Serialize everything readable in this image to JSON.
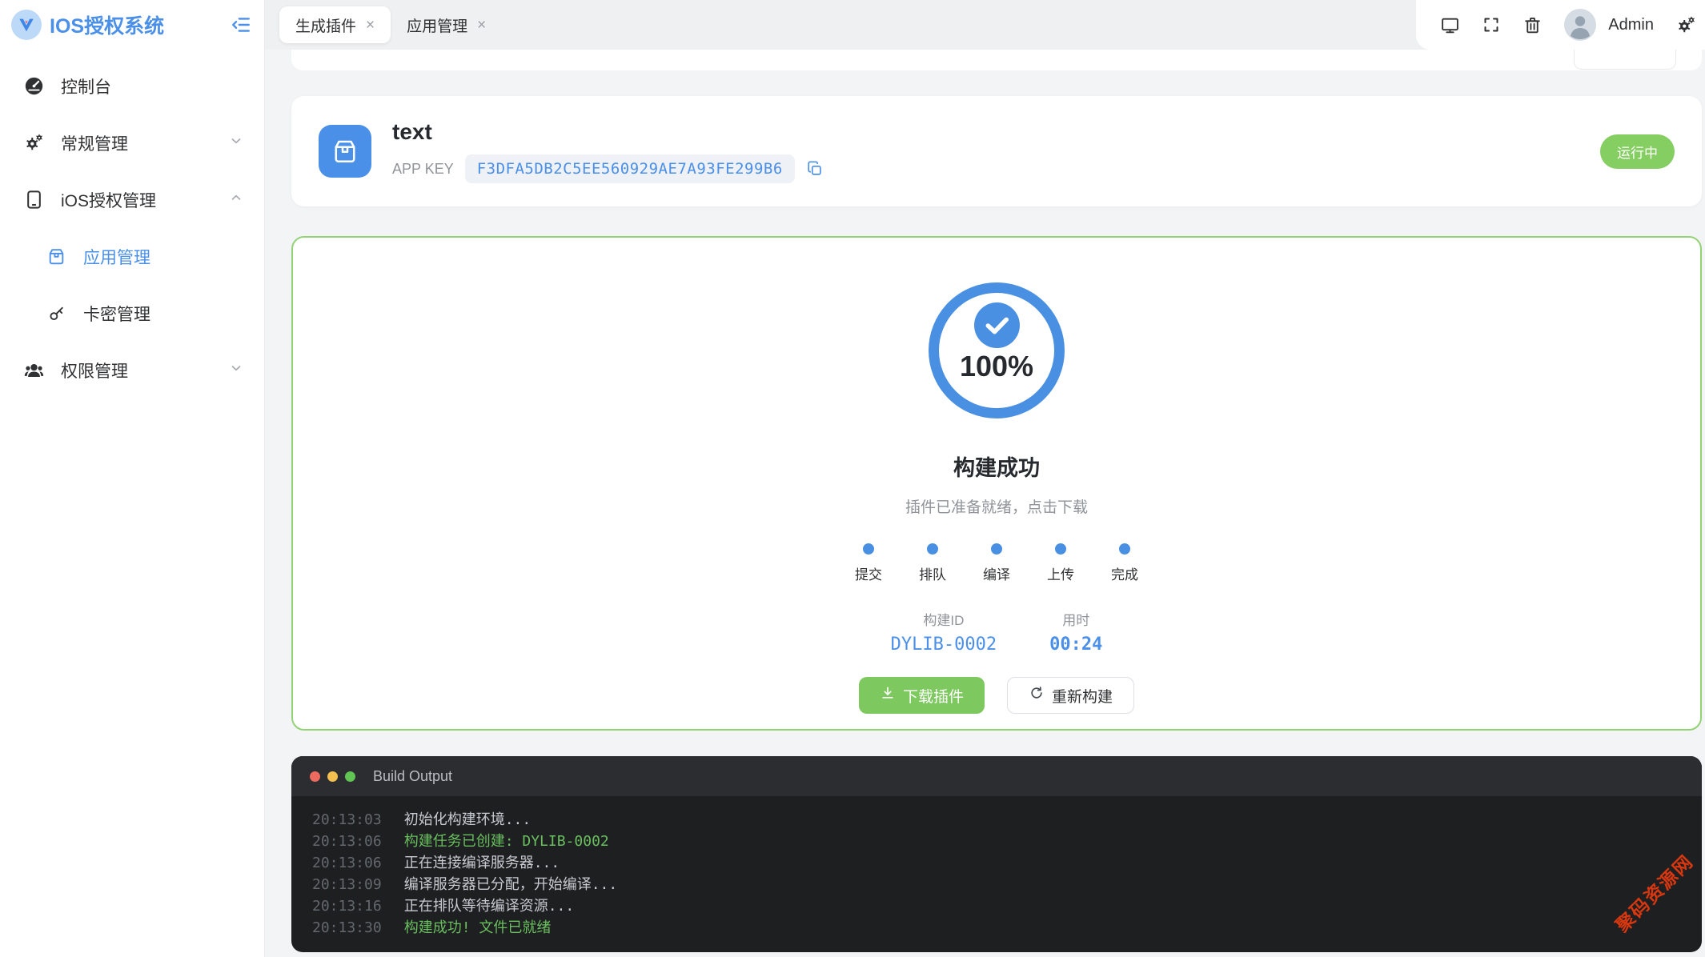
{
  "colors": {
    "accent_blue": "#4a8fe8",
    "progress_blue": "#4a90e2",
    "success_green": "#85ce61",
    "terminal_green": "#6abf5e",
    "watermark_red": "#e93a0e"
  },
  "app": {
    "logo_title": "IOS授权系统"
  },
  "topbar": {
    "tabs": [
      {
        "label": "生成插件"
      },
      {
        "label": "应用管理"
      }
    ],
    "close_glyph": "×",
    "username": "Admin"
  },
  "sidebar": {
    "items": [
      {
        "label": "控制台"
      },
      {
        "label": "常规管理"
      },
      {
        "label": "iOS授权管理"
      },
      {
        "label": "应用管理"
      },
      {
        "label": "卡密管理"
      },
      {
        "label": "权限管理"
      }
    ]
  },
  "app_card": {
    "name": "text",
    "key_label": "APP KEY",
    "key_value": "F3DFA5DB2C5EE560929AE7A93FE299B6",
    "status": "运行中"
  },
  "build": {
    "percent": "100%",
    "title": "构建成功",
    "subtitle": "插件已准备就绪，点击下载",
    "steps": [
      "提交",
      "排队",
      "编译",
      "上传",
      "完成"
    ],
    "id_label": "构建ID",
    "id_value": "DYLIB-0002",
    "time_label": "用时",
    "time_value": "00:24",
    "download_label": "下载插件",
    "rebuild_label": "重新构建"
  },
  "terminal": {
    "title": "Build Output",
    "lines": [
      {
        "time": "20:13:03",
        "text": "初始化构建环境...",
        "type": "normal"
      },
      {
        "time": "20:13:06",
        "text": "构建任务已创建: DYLIB-0002",
        "type": "success"
      },
      {
        "time": "20:13:06",
        "text": "正在连接编译服务器...",
        "type": "normal"
      },
      {
        "time": "20:13:09",
        "text": "编译服务器已分配，开始编译...",
        "type": "normal"
      },
      {
        "time": "20:13:16",
        "text": "正在排队等待编译资源...",
        "type": "normal"
      },
      {
        "time": "20:13:30",
        "text": "构建成功! 文件已就绪",
        "type": "success"
      }
    ]
  },
  "watermark": "聚码资源网"
}
